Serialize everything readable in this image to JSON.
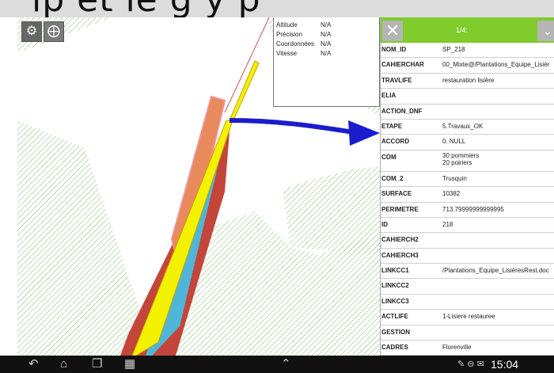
{
  "banner": {
    "text": "ip et le g y p"
  },
  "map": {
    "settings_icon": "gear-icon",
    "location_icon": "crosshair-icon",
    "colors": {
      "hatch": "#7fbf6a",
      "red": "#c4463a",
      "orange": "#e98a5c",
      "yellow": "#f2f200",
      "cyan": "#4fb6d8",
      "arrow": "#1c1ccf"
    }
  },
  "gps": {
    "rows": [
      {
        "label": "Altitude",
        "value": "N/A"
      },
      {
        "label": "Précision",
        "value": "N/A"
      },
      {
        "label": "Coordonnées",
        "value": "N/A"
      },
      {
        "label": "Vitesse",
        "value": "N/A"
      }
    ]
  },
  "attributes": {
    "page": "1/4:",
    "close_icon": "close-icon",
    "next_icon": "chevron-down-icon",
    "rows": [
      {
        "key": "NOM_ID",
        "value": "SP_218"
      },
      {
        "key": "CAHIERCHAR",
        "value": "00_Mixte@/Plantations_Equipe_Lisièr"
      },
      {
        "key": "TRAVLIFE",
        "value": "restauration lisière"
      },
      {
        "key": "ELIA",
        "value": ""
      },
      {
        "key": "ACTION_DNF",
        "value": ""
      },
      {
        "key": "ETAPE",
        "value": "5.Travaux_OK"
      },
      {
        "key": "ACCORD",
        "value": "0. NULL"
      },
      {
        "key": "COM",
        "value": "30 pommiers\n20 poiriers"
      },
      {
        "key": "COM_2",
        "value": "Trusquin"
      },
      {
        "key": "SURFACE",
        "value": "10382"
      },
      {
        "key": "PERIMETRE",
        "value": "713.79999999999995"
      },
      {
        "key": "ID",
        "value": "218"
      },
      {
        "key": "CAHIERCH2",
        "value": ""
      },
      {
        "key": "CAHIERCH3",
        "value": ""
      },
      {
        "key": "LINKCC1",
        "value": "/Plantations_Equipe_LisièresRest.doc"
      },
      {
        "key": "LINKCC2",
        "value": ""
      },
      {
        "key": "LINKCC3",
        "value": ""
      },
      {
        "key": "ACTLIFE",
        "value": "1-Lisiere restauree"
      },
      {
        "key": "GESTION",
        "value": ""
      },
      {
        "key": "CADRES",
        "value": "Florenville"
      }
    ]
  },
  "navbar": {
    "back_icon": "back-icon",
    "home_icon": "home-icon",
    "recents_icon": "recent-apps-icon",
    "screenshot_icon": "screenshot-icon",
    "up_icon": "chevron-up-icon",
    "time": "15:04"
  }
}
